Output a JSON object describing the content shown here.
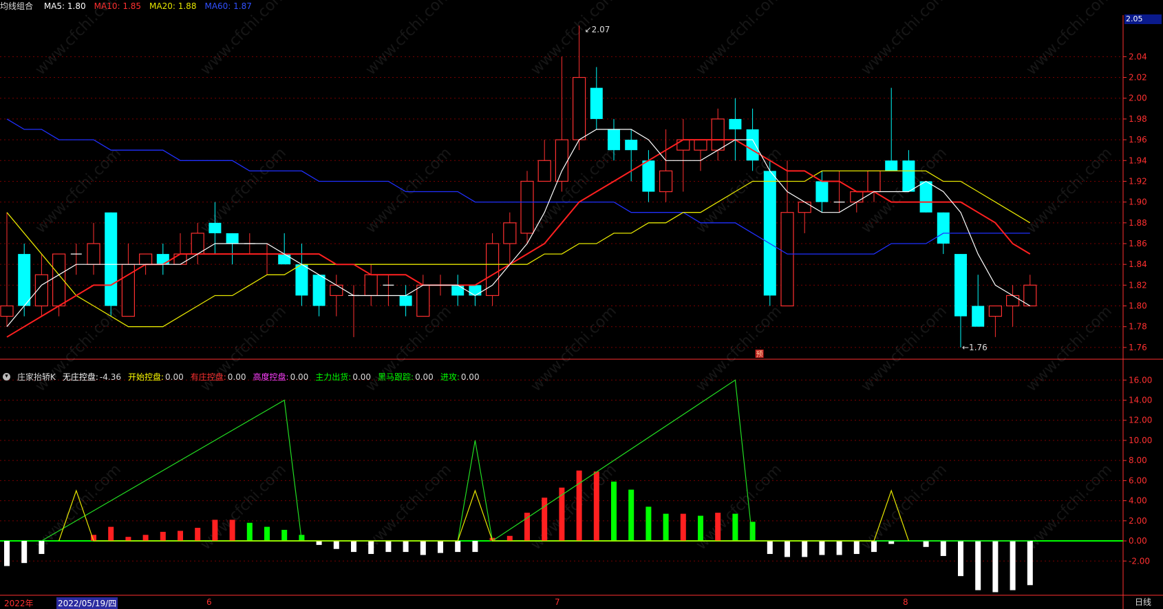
{
  "header": {
    "indicator_name": "均线组合",
    "items": [
      {
        "label": "MA5:",
        "value": "1.80",
        "color": "#ffffff"
      },
      {
        "label": "MA10:",
        "value": "1.85",
        "color": "#ff3030"
      },
      {
        "label": "MA20:",
        "value": "1.88",
        "color": "#e6e600"
      },
      {
        "label": "MA60:",
        "value": "1.87",
        "color": "#3050ff"
      }
    ]
  },
  "price_axis": {
    "ticks": [
      "2.04",
      "2.02",
      "2.00",
      "1.98",
      "1.96",
      "1.94",
      "1.92",
      "1.90",
      "1.88",
      "1.86",
      "1.84",
      "1.82",
      "1.80",
      "1.78",
      "1.76"
    ],
    "current_price": "2.05",
    "high_label": "2.07",
    "low_label": "1.76",
    "marker_char": "预"
  },
  "indicator": {
    "name": "庄家抬轿K",
    "legend": [
      {
        "label": "无庄控盘:",
        "value": "-4.36",
        "color": "#ffffff"
      },
      {
        "label": "开始控盘:",
        "value": "0.00",
        "color": "#ffff00"
      },
      {
        "label": "有庄控盘:",
        "value": "0.00",
        "color": "#ff3030"
      },
      {
        "label": "高度控盘:",
        "value": "0.00",
        "color": "#ff40ff"
      },
      {
        "label": "主力出货:",
        "value": "0.00",
        "color": "#00ff00"
      },
      {
        "label": "黑马跟踪:",
        "value": "0.00",
        "color": "#00ff00"
      },
      {
        "label": "进攻:",
        "value": "0.00",
        "color": "#00ff00"
      }
    ],
    "ticks": [
      "16.00",
      "14.00",
      "12.00",
      "10.00",
      "8.00",
      "6.00",
      "4.00",
      "2.00",
      "0.00",
      "-2.00"
    ]
  },
  "date_axis": {
    "labels": [
      "2022年",
      "2022/05/19/四",
      "6",
      "7",
      "8"
    ],
    "cycle": "日线"
  },
  "watermark": "www.cfchi.com",
  "colors": {
    "up": "#ff3030",
    "down": "#00ffff",
    "ma5": "#ffffff",
    "ma10": "#ff2020",
    "ma20": "#e6e600",
    "ma60": "#2030ff",
    "grid": "#7a0000",
    "axis": "#ff3030"
  },
  "chart_data": {
    "type": "candlestick",
    "candles": [
      [
        1.79,
        1.89,
        1.78,
        1.8
      ],
      [
        1.85,
        1.86,
        1.79,
        1.8
      ],
      [
        1.8,
        1.85,
        1.79,
        1.83
      ],
      [
        1.8,
        1.85,
        1.79,
        1.85
      ],
      [
        1.85,
        1.86,
        1.83,
        1.85
      ],
      [
        1.84,
        1.88,
        1.83,
        1.86
      ],
      [
        1.89,
        1.89,
        1.79,
        1.8
      ],
      [
        1.79,
        1.86,
        1.79,
        1.84
      ],
      [
        1.84,
        1.85,
        1.83,
        1.85
      ],
      [
        1.85,
        1.86,
        1.83,
        1.84
      ],
      [
        1.84,
        1.87,
        1.84,
        1.85
      ],
      [
        1.85,
        1.88,
        1.84,
        1.87
      ],
      [
        1.88,
        1.9,
        1.85,
        1.87
      ],
      [
        1.87,
        1.87,
        1.84,
        1.86
      ],
      [
        1.86,
        1.87,
        1.85,
        1.86
      ],
      [
        1.85,
        1.86,
        1.83,
        1.85
      ],
      [
        1.85,
        1.87,
        1.85,
        1.84
      ],
      [
        1.84,
        1.86,
        1.8,
        1.81
      ],
      [
        1.83,
        1.83,
        1.79,
        1.8
      ],
      [
        1.81,
        1.83,
        1.79,
        1.82
      ],
      [
        1.81,
        1.82,
        1.77,
        1.81
      ],
      [
        1.81,
        1.84,
        1.8,
        1.83
      ],
      [
        1.82,
        1.83,
        1.8,
        1.82
      ],
      [
        1.81,
        1.82,
        1.79,
        1.8
      ],
      [
        1.79,
        1.83,
        1.79,
        1.82
      ],
      [
        1.82,
        1.83,
        1.81,
        1.82
      ],
      [
        1.82,
        1.83,
        1.8,
        1.81
      ],
      [
        1.82,
        1.82,
        1.8,
        1.81
      ],
      [
        1.81,
        1.87,
        1.8,
        1.86
      ],
      [
        1.86,
        1.89,
        1.84,
        1.88
      ],
      [
        1.87,
        1.93,
        1.86,
        1.92
      ],
      [
        1.92,
        1.96,
        1.92,
        1.94
      ],
      [
        1.92,
        2.04,
        1.91,
        1.96
      ],
      [
        1.96,
        2.07,
        1.95,
        2.02
      ],
      [
        2.01,
        2.03,
        1.97,
        1.98
      ],
      [
        1.97,
        1.98,
        1.94,
        1.95
      ],
      [
        1.96,
        1.97,
        1.92,
        1.95
      ],
      [
        1.94,
        1.95,
        1.9,
        1.91
      ],
      [
        1.91,
        1.97,
        1.9,
        1.93
      ],
      [
        1.95,
        1.98,
        1.91,
        1.96
      ],
      [
        1.95,
        1.96,
        1.93,
        1.96
      ],
      [
        1.95,
        1.99,
        1.94,
        1.98
      ],
      [
        1.98,
        2.0,
        1.94,
        1.97
      ],
      [
        1.97,
        1.99,
        1.93,
        1.94
      ],
      [
        1.93,
        1.94,
        1.8,
        1.81
      ],
      [
        1.8,
        1.94,
        1.8,
        1.89
      ],
      [
        1.89,
        1.9,
        1.87,
        1.9
      ],
      [
        1.92,
        1.93,
        1.89,
        1.9
      ],
      [
        1.9,
        1.93,
        1.89,
        1.9
      ],
      [
        1.9,
        1.91,
        1.89,
        1.91
      ],
      [
        1.91,
        1.93,
        1.9,
        1.93
      ],
      [
        1.94,
        2.01,
        1.93,
        1.93
      ],
      [
        1.94,
        1.95,
        1.91,
        1.91
      ],
      [
        1.92,
        1.92,
        1.89,
        1.89
      ],
      [
        1.89,
        1.89,
        1.85,
        1.86
      ],
      [
        1.85,
        1.85,
        1.76,
        1.79
      ],
      [
        1.8,
        1.83,
        1.78,
        1.78
      ],
      [
        1.79,
        1.8,
        1.77,
        1.8
      ],
      [
        1.8,
        1.82,
        1.78,
        1.81
      ],
      [
        1.8,
        1.83,
        1.8,
        1.82
      ]
    ],
    "ma5": [
      1.78,
      1.8,
      1.82,
      1.83,
      1.84,
      1.84,
      1.84,
      1.84,
      1.84,
      1.84,
      1.84,
      1.85,
      1.86,
      1.86,
      1.86,
      1.86,
      1.85,
      1.84,
      1.83,
      1.82,
      1.81,
      1.81,
      1.81,
      1.81,
      1.82,
      1.82,
      1.82,
      1.81,
      1.82,
      1.84,
      1.86,
      1.89,
      1.93,
      1.96,
      1.97,
      1.97,
      1.97,
      1.96,
      1.94,
      1.94,
      1.94,
      1.95,
      1.96,
      1.96,
      1.93,
      1.91,
      1.9,
      1.89,
      1.89,
      1.9,
      1.91,
      1.91,
      1.91,
      1.92,
      1.91,
      1.89,
      1.85,
      1.82,
      1.81,
      1.8
    ],
    "ma10": [
      1.77,
      1.78,
      1.79,
      1.8,
      1.81,
      1.82,
      1.82,
      1.83,
      1.84,
      1.84,
      1.85,
      1.85,
      1.85,
      1.85,
      1.85,
      1.85,
      1.85,
      1.85,
      1.85,
      1.84,
      1.84,
      1.83,
      1.83,
      1.83,
      1.82,
      1.82,
      1.82,
      1.82,
      1.83,
      1.84,
      1.85,
      1.86,
      1.88,
      1.9,
      1.91,
      1.92,
      1.93,
      1.94,
      1.95,
      1.96,
      1.96,
      1.96,
      1.96,
      1.95,
      1.94,
      1.93,
      1.93,
      1.92,
      1.92,
      1.91,
      1.91,
      1.9,
      1.9,
      1.9,
      1.9,
      1.9,
      1.89,
      1.88,
      1.86,
      1.85
    ],
    "ma20": [
      1.89,
      1.87,
      1.85,
      1.83,
      1.81,
      1.8,
      1.79,
      1.78,
      1.78,
      1.78,
      1.79,
      1.8,
      1.81,
      1.81,
      1.82,
      1.83,
      1.83,
      1.84,
      1.84,
      1.84,
      1.84,
      1.84,
      1.84,
      1.84,
      1.84,
      1.84,
      1.84,
      1.84,
      1.84,
      1.84,
      1.84,
      1.85,
      1.85,
      1.86,
      1.86,
      1.87,
      1.87,
      1.88,
      1.88,
      1.89,
      1.89,
      1.9,
      1.91,
      1.92,
      1.92,
      1.92,
      1.92,
      1.93,
      1.93,
      1.93,
      1.93,
      1.93,
      1.93,
      1.93,
      1.92,
      1.92,
      1.91,
      1.9,
      1.89,
      1.88
    ],
    "ma60": [
      1.98,
      1.97,
      1.97,
      1.96,
      1.96,
      1.96,
      1.95,
      1.95,
      1.95,
      1.95,
      1.94,
      1.94,
      1.94,
      1.94,
      1.93,
      1.93,
      1.93,
      1.93,
      1.92,
      1.92,
      1.92,
      1.92,
      1.92,
      1.91,
      1.91,
      1.91,
      1.91,
      1.9,
      1.9,
      1.9,
      1.9,
      1.9,
      1.9,
      1.9,
      1.9,
      1.9,
      1.89,
      1.89,
      1.89,
      1.89,
      1.88,
      1.88,
      1.88,
      1.87,
      1.86,
      1.85,
      1.85,
      1.85,
      1.85,
      1.85,
      1.85,
      1.86,
      1.86,
      1.86,
      1.87,
      1.87,
      1.87,
      1.87,
      1.87,
      1.87
    ],
    "indicator_bars": [
      -2.5,
      -2.2,
      -1.3,
      0,
      0,
      0.6,
      1.4,
      0.4,
      0.6,
      0.9,
      1.0,
      1.3,
      2.1,
      2.1,
      1.8,
      1.4,
      1.1,
      0.6,
      -0.4,
      -0.8,
      -1.1,
      -1.3,
      -1.1,
      -1.1,
      -1.4,
      -1.2,
      -1.1,
      -1.1,
      0.3,
      0.5,
      2.8,
      4.3,
      5.3,
      7.0,
      6.9,
      5.9,
      5.1,
      3.4,
      2.7,
      2.7,
      2.5,
      2.8,
      2.7,
      1.9,
      -1.3,
      -1.6,
      -1.6,
      -1.4,
      -1.4,
      -1.3,
      -1.1,
      -0.3,
      0,
      -0.6,
      -1.5,
      -3.5,
      -4.9,
      -5.1,
      -4.9,
      -4.4
    ],
    "green_line": [
      [
        2,
        0
      ],
      [
        16,
        14
      ],
      [
        17,
        0
      ],
      [
        26,
        0
      ],
      [
        27,
        10
      ],
      [
        28,
        0
      ],
      [
        42,
        16
      ],
      [
        43,
        0
      ],
      [
        59,
        0
      ]
    ],
    "yellow_line": [
      [
        3,
        0
      ],
      [
        4,
        5
      ],
      [
        5,
        0
      ],
      [
        26,
        0
      ],
      [
        27,
        5
      ],
      [
        28,
        0
      ],
      [
        50,
        0
      ],
      [
        51,
        5
      ],
      [
        52,
        0
      ]
    ],
    "price_ylim": [
      1.75,
      2.08
    ],
    "ind_ylim": [
      -5.2,
      16.5
    ]
  }
}
